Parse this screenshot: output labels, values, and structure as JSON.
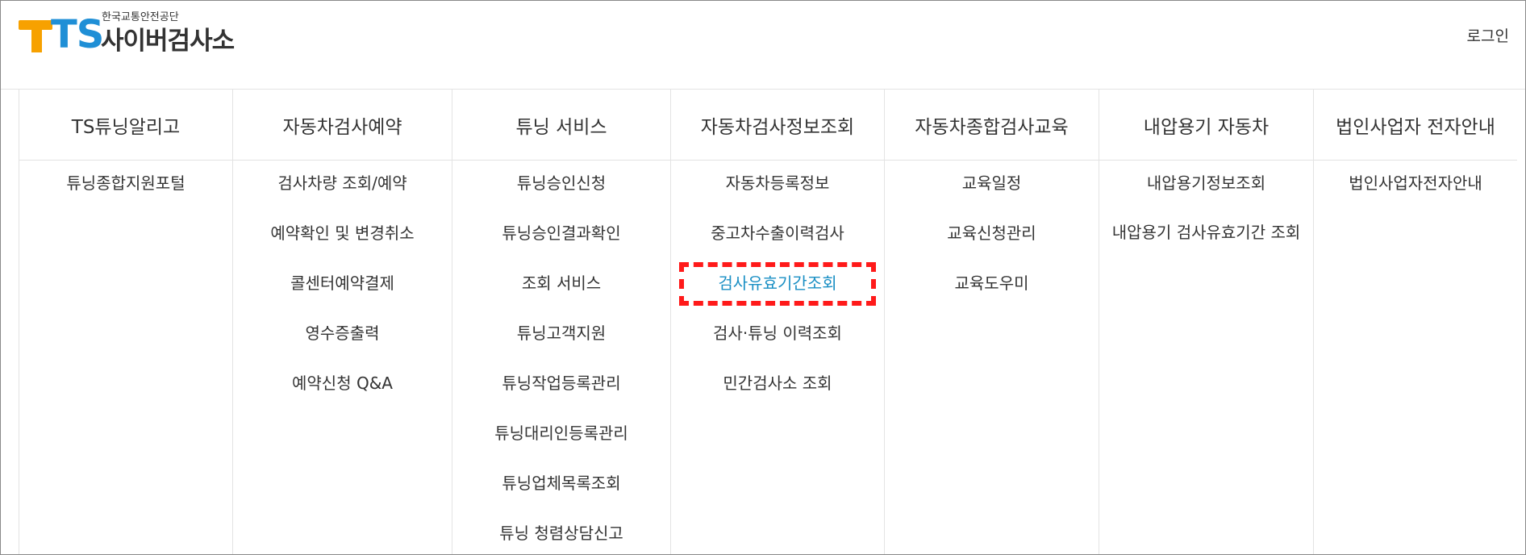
{
  "header": {
    "logo_mark": "TS",
    "logo_sub": "한국교통안전공단",
    "logo_main": "사이버검사소",
    "login_label": "로그인"
  },
  "menu": [
    {
      "title": "TS튜닝알리고",
      "items": [
        "튜닝종합지원포털"
      ]
    },
    {
      "title": "자동차검사예약",
      "items": [
        "검사차량 조회/예약",
        "예약확인 및 변경취소",
        "콜센터예약결제",
        "영수증출력",
        "예약신청 Q&A"
      ]
    },
    {
      "title": "튜닝 서비스",
      "items": [
        "튜닝승인신청",
        "튜닝승인결과확인",
        "조회 서비스",
        "튜닝고객지원",
        "튜닝작업등록관리",
        "튜닝대리인등록관리",
        "튜닝업체목록조회",
        "튜닝 청렴상담신고"
      ]
    },
    {
      "title": "자동차검사정보조회",
      "items": [
        "자동차등록정보",
        "중고차수출이력검사",
        "검사유효기간조회",
        "검사·튜닝 이력조회",
        "민간검사소 조회"
      ]
    },
    {
      "title": "자동차종합검사교육",
      "items": [
        "교육일정",
        "교육신청관리",
        "교육도우미"
      ]
    },
    {
      "title": "내압용기 자동차",
      "items": [
        "내압용기정보조회",
        "내압용기 검사유효기간 조회"
      ]
    },
    {
      "title": "법인사업자 전자안내",
      "items": [
        "법인사업자전자안내"
      ]
    }
  ],
  "active_item": "검사유효기간조회",
  "colors": {
    "accent": "#1a8fc4",
    "logo_orange": "#f7a100",
    "logo_blue": "#1f8fd6",
    "highlight": "#ff1a1a"
  }
}
